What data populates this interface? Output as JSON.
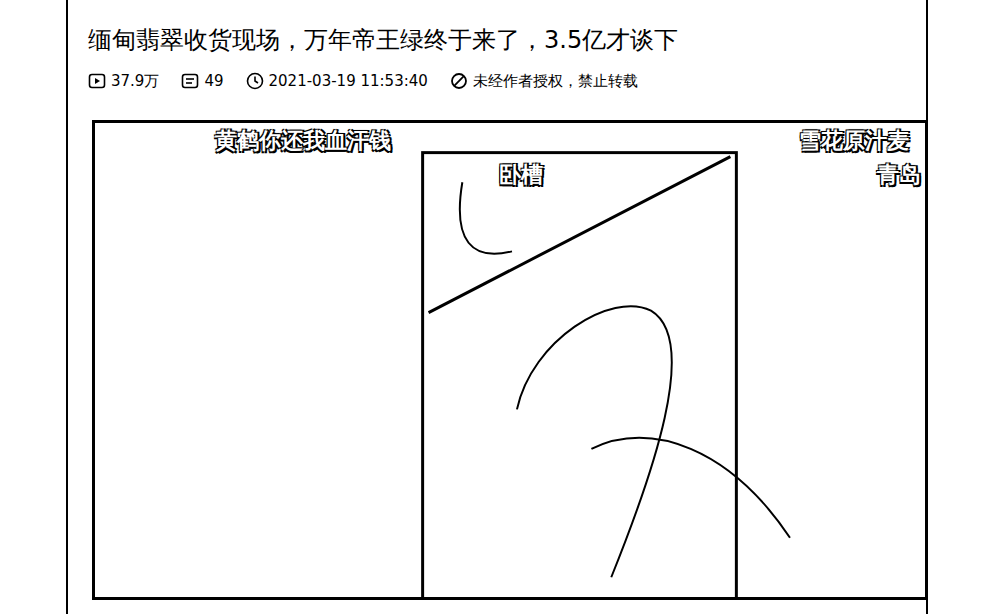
{
  "article": {
    "title": "缅甸翡翠收货现场，万年帝王绿终于来了，3.5亿才谈下",
    "stats": [
      {
        "kind": "views",
        "text": "37.9万"
      },
      {
        "kind": "comments",
        "text": "49"
      },
      {
        "kind": "time",
        "text": "2021-03-19 11:53:40"
      },
      {
        "kind": "notice",
        "text": "未经作者授权，禁止转载"
      }
    ]
  },
  "video": {
    "danmaku": [
      {
        "text": "黄鹤你还我血汗钱"
      },
      {
        "text": "卧槽"
      },
      {
        "text": "雪花原汁麦"
      },
      {
        "text": "青岛"
      }
    ]
  }
}
